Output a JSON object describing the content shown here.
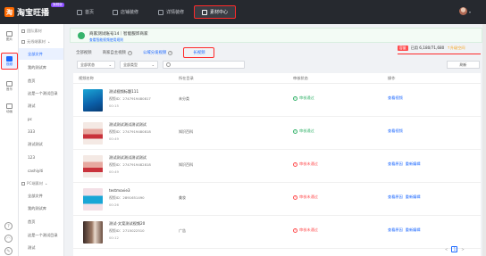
{
  "brand": {
    "name": "淘宝旺播",
    "badge": "旗舰版"
  },
  "topnav": [
    {
      "label": "首页",
      "icon": "home-icon"
    },
    {
      "label": "店铺装修",
      "icon": "store-icon"
    },
    {
      "label": "详情装修",
      "icon": "detail-icon"
    },
    {
      "label": "素材中心",
      "icon": "folder-icon",
      "active": true
    }
  ],
  "rail": [
    {
      "label": "图片",
      "icon": "image-icon"
    },
    {
      "label": "视频",
      "icon": "video-icon",
      "active": true
    },
    {
      "label": "音乐",
      "icon": "music-icon"
    },
    {
      "label": "动画",
      "icon": "animation-icon"
    }
  ],
  "sidebar": [
    {
      "label": "团队素材",
      "group": true
    },
    {
      "label": "无线端素材",
      "group": true,
      "caret": true
    },
    {
      "label": "全部文件",
      "selected": true
    },
    {
      "label": "我的测试库"
    },
    {
      "label": "首页"
    },
    {
      "label": "这是一个测试目录"
    },
    {
      "label": "测试"
    },
    {
      "label": "pc"
    },
    {
      "label": "333"
    },
    {
      "label": "测试测试"
    },
    {
      "label": "123"
    },
    {
      "label": "cashiyiti"
    },
    {
      "label": "PC端素材",
      "group": true,
      "caret": true
    },
    {
      "label": "全部文件"
    },
    {
      "label": "我的测试库"
    },
    {
      "label": "首页"
    },
    {
      "label": "这是一个测试目录"
    },
    {
      "label": "测试"
    }
  ],
  "notice": {
    "title": "商家测试账号14｜智能服饰商家",
    "sub": "查看智能视频使用规则"
  },
  "usage": {
    "badge": "容量",
    "text": "已用 6,180/71,680",
    "upgrade": "↑升级空间"
  },
  "tabs": [
    {
      "label": "全部视频"
    },
    {
      "label": "商家自主视频",
      "help": true
    },
    {
      "label": "公域分发视频",
      "help": true,
      "blue": true
    },
    {
      "label": "长视频",
      "active": true
    }
  ],
  "filters": {
    "status": "全部状态",
    "type": "全部类型",
    "search_placeholder": "",
    "refresh": "刷新"
  },
  "columns": {
    "name": "视频名称",
    "position": "所在目录",
    "review": "审核状态",
    "ops": "操作"
  },
  "rows": [
    {
      "name": "测试视频标题111",
      "id": "视频ID：2747919480817",
      "dur": "00:15",
      "position": "未分类",
      "status": "审核通过",
      "status_kind": "ok",
      "ops": [
        "查看视频"
      ],
      "thumb": "blue"
    },
    {
      "name": "测试测试测试测试测试",
      "id": "视频ID：2747919480818",
      "dur": "00:49",
      "position": "知识百科",
      "status": "审核通过",
      "status_kind": "ok",
      "ops": [
        "查看视频"
      ],
      "thumb": "beauty"
    },
    {
      "name": "测试测试测试测试测试",
      "id": "视频ID：2747919482818",
      "dur": "00:49",
      "position": "知识百科",
      "status": "审核未通过",
      "status_kind": "fail",
      "ops": [
        "查看原因",
        "重新编辑"
      ],
      "thumb": "beauty"
    },
    {
      "name": "testmovie3",
      "id": "视频ID：2891651490",
      "dur": "00:26",
      "position": "美妆",
      "status": "审核未通过",
      "status_kind": "fail",
      "ops": [
        "查看原因",
        "重新编辑"
      ],
      "thumb": "pink"
    },
    {
      "name": "测试-文案测试视频20",
      "id": "视频ID：2715022510",
      "dur": "00:12",
      "position": "广告",
      "status": "审核未通过",
      "status_kind": "fail",
      "ops": [
        "查看原因",
        "重新编辑"
      ],
      "thumb": "dark"
    }
  ],
  "pager": {
    "prev": "<",
    "page": "1",
    "next": ">"
  }
}
